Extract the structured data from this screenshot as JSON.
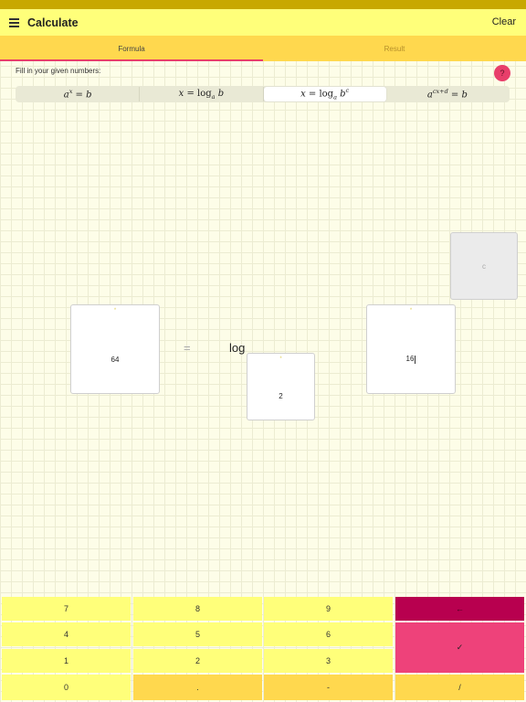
{
  "app": {
    "title": "Calculate",
    "clear_label": "Clear"
  },
  "tabs": [
    {
      "label": "Formula",
      "active": true
    },
    {
      "label": "Result",
      "active": false
    }
  ],
  "instruction": "Fill in your given numbers:",
  "help_label": "?",
  "formula_options": [
    {
      "id": "exp",
      "text": "a^x = b"
    },
    {
      "id": "log",
      "text": "x = log_a b"
    },
    {
      "id": "log-power",
      "text": "x = log_a b^c",
      "selected": true
    },
    {
      "id": "exp-linear",
      "text": "a^(cx+d) = b"
    }
  ],
  "equation": {
    "b_value": "64",
    "equals_sign": "=",
    "log_label": "log",
    "base_value": "2",
    "power_value": "16",
    "c_placeholder": "c",
    "marker": "*"
  },
  "keypad": {
    "rows": [
      [
        "7",
        "8",
        "9"
      ],
      [
        "4",
        "5",
        "6"
      ],
      [
        "1",
        "2",
        "3"
      ],
      [
        "0",
        ".",
        "-"
      ]
    ],
    "backspace_symbol": "←",
    "confirm_symbol": "✓",
    "divide_symbol": "/"
  },
  "colors": {
    "accent_pink": "#ee427a",
    "backspace_red": "#b8004f",
    "key_yellow": "#ffff7a",
    "key_gold": "#ffd84e"
  }
}
